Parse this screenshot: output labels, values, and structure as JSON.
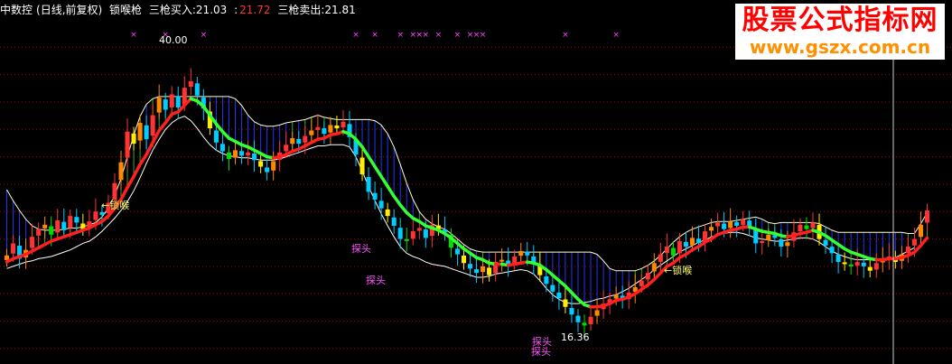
{
  "header": {
    "stock_name": "中数控",
    "period": "(日线,前复权)",
    "indicator_name": "锁喉枪",
    "buy_label": "三枪买入:",
    "buy_value": "21.03",
    "mid_value": "21.72",
    "sell_label": "三枪卖出:",
    "sell_value": "21.81"
  },
  "watermark": {
    "line1": "股票公式指标网",
    "line2": "www.gszx.com.cn"
  },
  "annotations": {
    "high_price": "40.00",
    "low_price": "16.36",
    "lock1": "←锁喉",
    "lock2": "←锁喉",
    "probe1": "探头",
    "probe2": "探头",
    "probe3": "探头",
    "probe4": "探头"
  },
  "colors": {
    "rising": "#ff3333",
    "falling": "#00ccff",
    "yellow": "#ffee00",
    "orange": "#ff8800",
    "green": "#00dd00",
    "red_line": "#ff2020",
    "green_line": "#33ff33",
    "upper_line": "#ffffcc",
    "lower_line": "#ffffff",
    "fill_blue": "#2233ff",
    "fill_green": "#33aa33",
    "marker": "#ff44ff",
    "grid": "#aa0000",
    "label_yellow": "#ffff66",
    "label_magenta": "#ff55ff"
  },
  "chart_data": {
    "type": "candlestick",
    "title": "",
    "ylim": [
      14,
      45
    ],
    "series": [
      {
        "name": "close",
        "values": [
          23.5,
          24.6,
          23.2,
          24.0,
          25.2,
          25.9,
          26.3,
          25.4,
          26.7,
          25.8,
          27.1,
          26.5,
          25.9,
          26.6,
          27.5,
          27.2,
          28.3,
          30.1,
          32.0,
          34.8,
          33.7,
          35.6,
          34.1,
          36.3,
          37.9,
          36.8,
          38.2,
          37.0,
          38.8,
          39.4,
          38.1,
          36.9,
          35.1,
          33.8,
          33.0,
          32.3,
          33.1,
          32.6,
          32.9,
          32.2,
          31.6,
          31.1,
          32.1,
          32.9,
          33.6,
          34.2,
          33.7,
          34.4,
          34.9,
          35.2,
          34.6,
          35.4,
          35.1,
          35.7,
          34.3,
          32.7,
          30.9,
          29.3,
          28.6,
          27.8,
          27.1,
          26.2,
          25.0,
          24.9,
          25.7,
          26.0,
          25.1,
          26.3,
          25.9,
          25.6,
          24.2,
          23.6,
          22.8,
          22.3,
          21.9,
          22.5,
          21.7,
          22.9,
          23.1,
          22.6,
          23.4,
          23.9,
          23.5,
          22.8,
          21.7,
          20.9,
          20.2,
          19.6,
          18.8,
          18.1,
          17.4,
          17.1,
          17.9,
          18.5,
          19.1,
          19.5,
          19.9,
          19.4,
          20.1,
          20.6,
          21.2,
          21.9,
          22.8,
          23.6,
          24.3,
          23.5,
          24.8,
          24.3,
          25.1,
          24.6,
          25.7,
          26.1,
          26.5,
          25.9,
          26.6,
          26.2,
          26.8,
          26.0,
          24.6,
          24.8,
          25.4,
          25.1,
          24.3,
          24.7,
          25.6,
          26.3,
          25.9,
          26.5,
          25.0,
          24.4,
          23.7,
          22.9,
          22.7,
          22.5,
          22.9,
          22.5,
          22.1,
          22.8,
          23.2,
          23.4,
          22.9,
          23.6,
          24.3,
          25.0,
          26.3,
          27.6
        ]
      },
      {
        "name": "upper",
        "values": [
          29.5,
          28.5,
          27.6,
          26.8,
          26.2,
          25.9,
          25.8,
          25.8,
          25.8,
          25.9,
          26.0,
          26.0,
          26.1,
          26.3,
          26.5,
          27.0,
          27.8,
          29.0,
          30.5,
          32.5,
          34.5,
          36.2,
          37.3,
          37.8,
          38.0,
          38.0,
          38.0,
          38.0,
          38.0,
          38.0,
          38.0,
          38.0,
          38.0,
          38.0,
          38.0,
          38.0,
          37.8,
          37.2,
          36.3,
          35.7,
          35.4,
          35.3,
          35.3,
          35.4,
          35.6,
          35.7,
          35.8,
          35.9,
          36.1,
          36.3,
          36.1,
          36.0,
          35.9,
          35.9,
          35.9,
          35.9,
          35.9,
          35.9,
          35.8,
          35.4,
          34.6,
          33.4,
          31.8,
          30.1,
          28.6,
          27.5,
          26.8,
          26.4,
          26.1,
          25.9,
          25.5,
          25.0,
          24.5,
          24.1,
          23.9,
          23.8,
          23.8,
          23.8,
          23.8,
          23.8,
          23.8,
          23.8,
          23.8,
          23.8,
          23.8,
          23.8,
          23.8,
          23.8,
          23.8,
          23.8,
          23.8,
          23.8,
          23.8,
          23.6,
          23.0,
          22.3,
          22.1,
          22.1,
          22.1,
          22.1,
          22.3,
          22.6,
          23.0,
          23.5,
          24.1,
          24.7,
          25.2,
          25.6,
          25.9,
          26.1,
          26.3,
          26.5,
          26.6,
          26.6,
          26.6,
          26.7,
          26.8,
          26.9,
          27.0,
          26.8,
          26.5,
          26.4,
          26.5,
          26.5,
          26.5,
          26.5,
          26.5,
          26.5,
          26.4,
          26.1,
          25.8,
          25.6,
          25.6,
          25.6,
          25.6,
          25.6,
          25.6,
          25.6,
          25.6,
          25.6,
          25.6,
          25.6,
          25.5,
          25.5,
          26.4,
          27.4
        ]
      },
      {
        "name": "lower",
        "values": [
          22.3,
          22.5,
          22.7,
          22.9,
          23.0,
          23.2,
          23.3,
          23.4,
          23.6,
          23.8,
          24.0,
          24.3,
          24.6,
          24.8,
          25.2,
          25.7,
          26.3,
          26.9,
          27.6,
          28.4,
          29.4,
          30.6,
          31.9,
          33.1,
          34.1,
          35.0,
          35.6,
          36.0,
          36.2,
          35.8,
          35.1,
          34.3,
          33.6,
          33.1,
          32.8,
          32.6,
          32.5,
          32.4,
          32.4,
          32.3,
          32.2,
          32.2,
          32.2,
          32.3,
          32.5,
          32.7,
          32.9,
          33.1,
          33.3,
          33.5,
          33.5,
          33.6,
          33.6,
          33.6,
          33.4,
          32.5,
          31.2,
          29.8,
          28.5,
          27.3,
          26.2,
          25.2,
          24.3,
          23.7,
          23.4,
          23.2,
          22.9,
          22.7,
          22.6,
          22.5,
          22.3,
          22.1,
          21.9,
          21.7,
          21.5,
          21.5,
          21.6,
          21.8,
          21.9,
          22.0,
          22.1,
          22.2,
          22.1,
          21.8,
          21.2,
          20.5,
          19.9,
          19.5,
          19.2,
          19.1,
          19.1,
          19.2,
          19.3,
          19.5,
          19.6,
          19.8,
          19.9,
          20.2,
          20.5,
          20.9,
          21.3,
          21.7,
          22.2,
          22.6,
          23.0,
          23.4,
          23.8,
          24.1,
          24.4,
          24.7,
          24.9,
          25.2,
          25.4,
          25.5,
          25.6,
          25.6,
          25.5,
          25.3,
          25.1,
          25.0,
          24.9,
          24.8,
          24.8,
          24.9,
          25.0,
          25.1,
          25.1,
          25.0,
          24.7,
          24.3,
          23.9,
          23.6,
          23.4,
          23.2,
          23.1,
          23.1,
          23.1,
          23.1,
          23.2,
          23.2,
          23.3,
          23.6,
          23.9,
          24.2
        ]
      },
      {
        "name": "mid",
        "values": [
          22.9,
          23.2,
          23.4,
          23.6,
          23.9,
          24.2,
          24.5,
          24.8,
          25.0,
          25.2,
          25.4,
          25.6,
          25.8,
          26.0,
          26.3,
          26.6,
          27.1,
          27.8,
          28.6,
          29.7,
          30.7,
          31.8,
          32.7,
          33.8,
          34.9,
          35.6,
          36.4,
          36.6,
          37.2,
          37.8,
          37.6,
          37.1,
          36.3,
          35.5,
          34.8,
          34.2,
          33.9,
          33.6,
          33.4,
          33.1,
          32.8,
          32.5,
          32.4,
          32.5,
          32.7,
          33.0,
          33.2,
          33.5,
          33.8,
          34.1,
          34.2,
          34.5,
          34.6,
          34.8,
          34.6,
          34.1,
          33.4,
          32.5,
          31.6,
          30.7,
          29.8,
          28.9,
          28.1,
          27.4,
          26.9,
          26.6,
          26.2,
          26.0,
          25.8,
          25.5,
          25.1,
          24.6,
          24.1,
          23.7,
          23.3,
          23.1,
          22.8,
          22.7,
          22.7,
          22.6,
          22.7,
          22.8,
          22.9,
          22.8,
          22.6,
          22.2,
          21.7,
          21.2,
          20.7,
          20.1,
          19.5,
          19.0,
          18.8,
          18.8,
          18.9,
          19.1,
          19.4,
          19.5,
          19.7,
          20.0,
          20.4,
          20.8,
          21.3,
          21.9,
          22.5,
          22.8,
          23.3,
          23.6,
          24.0,
          24.3,
          24.7,
          25.0,
          25.4,
          25.6,
          25.8,
          25.9,
          26.1,
          26.1,
          25.9,
          25.7,
          25.6,
          25.5,
          25.3,
          25.2,
          25.3,
          25.5,
          25.6,
          25.8,
          25.6,
          25.3,
          24.9,
          24.5,
          24.1,
          23.8,
          23.6,
          23.4,
          23.2,
          23.1,
          23.1,
          23.2,
          23.2,
          23.3,
          23.5,
          23.8,
          24.4,
          25.1
        ]
      }
    ],
    "markers_x_index": [
      20,
      25,
      31,
      55,
      58,
      62,
      64,
      65,
      66,
      68,
      71,
      73,
      74,
      75,
      88,
      96
    ]
  }
}
